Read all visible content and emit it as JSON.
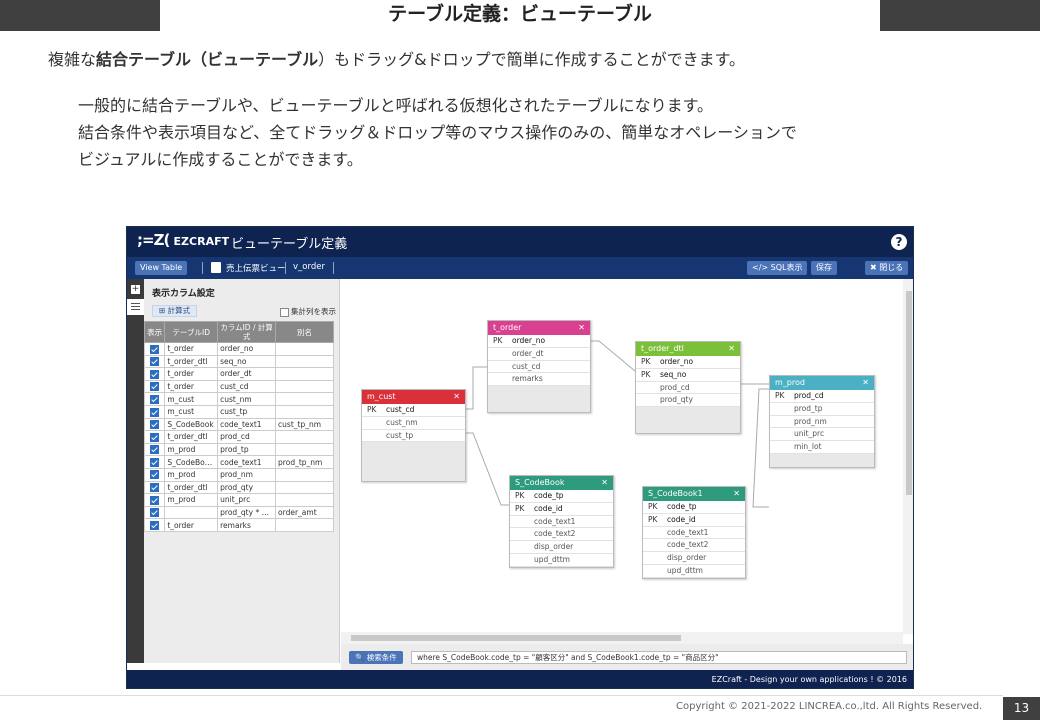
{
  "slide": {
    "title": "テーブル定義：ビューテーブル",
    "intro_pre": "複雑な",
    "intro_bold": "結合テーブル（ビューテーブル",
    "intro_post": "）もドラッグ&ドロップで簡単に作成することができます。",
    "lines": [
      "一般的に結合テーブルや、ビューテーブルと呼ばれる仮想化されたテーブルになります。",
      "結合条件や表示項目など、全てドラッグ＆ドロップ等のマウス操作のみの、簡単なオペレーションで",
      "ビジュアルに作成することができます。"
    ],
    "copyright": "Copyright © 2021-2022 LINCREA.co.,ltd. All Rights Reserved.",
    "page_number": "13"
  },
  "app": {
    "logo": "EZCRAFT",
    "title": "ビューテーブル定義",
    "help": "?",
    "toolbar": {
      "view_table": "View Table",
      "crumb1": "売上伝票ビュー",
      "crumb2": "v_order",
      "sql": "</> SQL表示",
      "save": "保存",
      "close": "✖ 閉じる"
    },
    "left": {
      "title": "表示カラム設定",
      "calc_button": "⊞ 計算式",
      "aggregate_label": "集計列を表示",
      "headers": [
        "表示",
        "テーブルID",
        "カラムID / 計算式",
        "別名"
      ],
      "rows": [
        [
          "t_order",
          "order_no",
          ""
        ],
        [
          "t_order_dtl",
          "seq_no",
          ""
        ],
        [
          "t_order",
          "order_dt",
          ""
        ],
        [
          "t_order",
          "cust_cd",
          ""
        ],
        [
          "m_cust",
          "cust_nm",
          ""
        ],
        [
          "m_cust",
          "cust_tp",
          ""
        ],
        [
          "S_CodeBook",
          "code_text1",
          "cust_tp_nm"
        ],
        [
          "t_order_dtl",
          "prod_cd",
          ""
        ],
        [
          "m_prod",
          "prod_tp",
          ""
        ],
        [
          "S_CodeBo…",
          "code_text1",
          "prod_tp_nm"
        ],
        [
          "m_prod",
          "prod_nm",
          ""
        ],
        [
          "t_order_dtl",
          "prod_qty",
          ""
        ],
        [
          "m_prod",
          "unit_prc",
          ""
        ],
        [
          "",
          "prod_qty * …",
          "order_amt"
        ],
        [
          "t_order",
          "remarks",
          ""
        ]
      ]
    },
    "tables": {
      "t_order": {
        "name": "t_order",
        "color": "#d9408f",
        "rows": [
          [
            "PK",
            "order_no"
          ],
          [
            "",
            "order_dt"
          ],
          [
            "",
            "cust_cd"
          ],
          [
            "",
            "remarks"
          ]
        ]
      },
      "m_cust": {
        "name": "m_cust",
        "color": "#d9303a",
        "rows": [
          [
            "PK",
            "cust_cd"
          ],
          [
            "",
            "cust_nm"
          ],
          [
            "",
            "cust_tp"
          ]
        ]
      },
      "t_order_dtl": {
        "name": "t_order_dtl",
        "color": "#7cc03a",
        "rows": [
          [
            "PK",
            "order_no"
          ],
          [
            "PK",
            "seq_no"
          ],
          [
            "",
            "prod_cd"
          ],
          [
            "",
            "prod_qty"
          ]
        ]
      },
      "m_prod": {
        "name": "m_prod",
        "color": "#4bb0c4",
        "rows": [
          [
            "PK",
            "prod_cd"
          ],
          [
            "",
            "prod_tp"
          ],
          [
            "",
            "prod_nm"
          ],
          [
            "",
            "unit_prc"
          ],
          [
            "",
            "min_lot"
          ]
        ]
      },
      "s_codebook": {
        "name": "S_CodeBook",
        "color": "#2e9b7e",
        "rows": [
          [
            "PK",
            "code_tp"
          ],
          [
            "PK",
            "code_id"
          ],
          [
            "",
            "code_text1"
          ],
          [
            "",
            "code_text2"
          ],
          [
            "",
            "disp_order"
          ],
          [
            "",
            "upd_dttm"
          ]
        ]
      },
      "s_codebook1": {
        "name": "S_CodeBook1",
        "color": "#2e9b7e",
        "rows": [
          [
            "PK",
            "code_tp"
          ],
          [
            "PK",
            "code_id"
          ],
          [
            "",
            "code_text1"
          ],
          [
            "",
            "code_text2"
          ],
          [
            "",
            "disp_order"
          ],
          [
            "",
            "upd_dttm"
          ]
        ]
      }
    },
    "search_button": "検索条件",
    "where": "where S_CodeBook.code_tp = \"顧客区分\" and S_CodeBook1.code_tp = \"商品区分\"",
    "footer": "EZCraft - Design your own applications ! © 2016"
  }
}
